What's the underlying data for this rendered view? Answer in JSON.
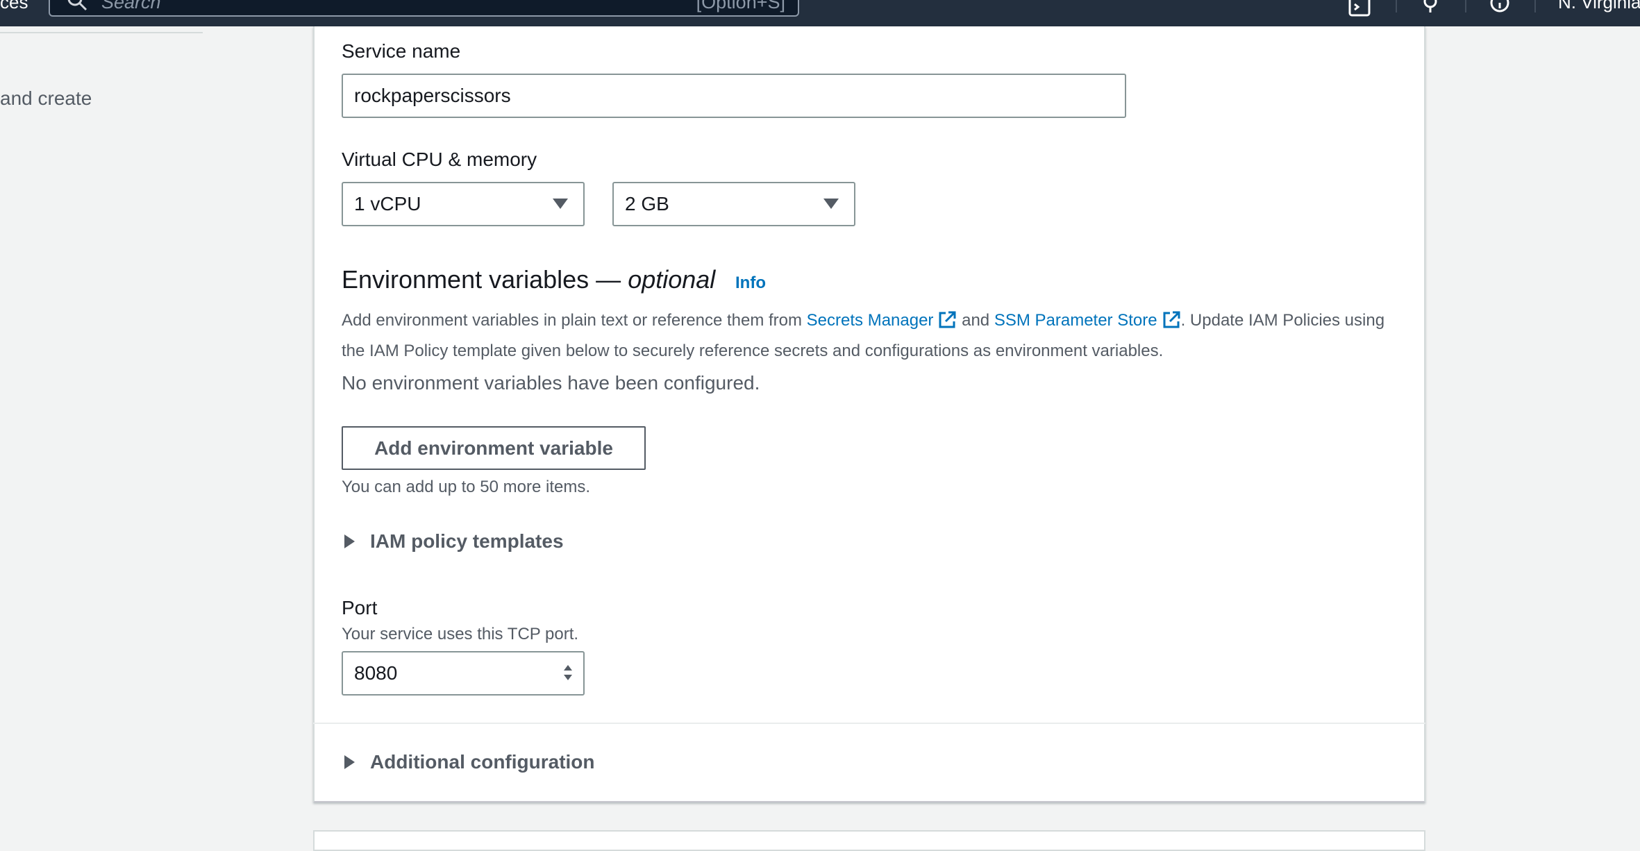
{
  "topbar": {
    "nav_left_text": "ces",
    "search_placeholder": "Search",
    "search_shortcut": "[Option+S]",
    "region": "N. Virginia",
    "icons": [
      "cloudshell-icon",
      "bell-icon",
      "help-icon"
    ]
  },
  "sidebar": {
    "item_text": "and create"
  },
  "form": {
    "service_name": {
      "label": "Service name",
      "value": "rockpaperscissors"
    },
    "cpu_memory": {
      "label": "Virtual CPU & memory",
      "cpu_value": "1 vCPU",
      "memory_value": "2 GB"
    },
    "env_vars": {
      "heading": "Environment variables —",
      "heading_optional": "optional",
      "info": "Info",
      "desc_part1": "Add environment variables in plain text or reference them from",
      "link_secrets": "Secrets Manager",
      "desc_and": "and",
      "link_ssm": "SSM Parameter Store",
      "desc_part2": ". Update IAM Policies using the IAM Policy template given below to securely reference secrets and configurations as environment variables.",
      "empty_message": "No environment variables have been configured.",
      "add_button": "Add environment variable",
      "limit_note": "You can add up to 50 more items."
    },
    "iam_templates": {
      "label": "IAM policy templates"
    },
    "port": {
      "label": "Port",
      "desc": "Your service uses this TCP port.",
      "value": "8080"
    },
    "additional_config": {
      "label": "Additional configuration"
    }
  },
  "colors": {
    "nav_bg": "#232f3e",
    "link": "#0073bb",
    "page_bg": "#f2f3f3"
  }
}
